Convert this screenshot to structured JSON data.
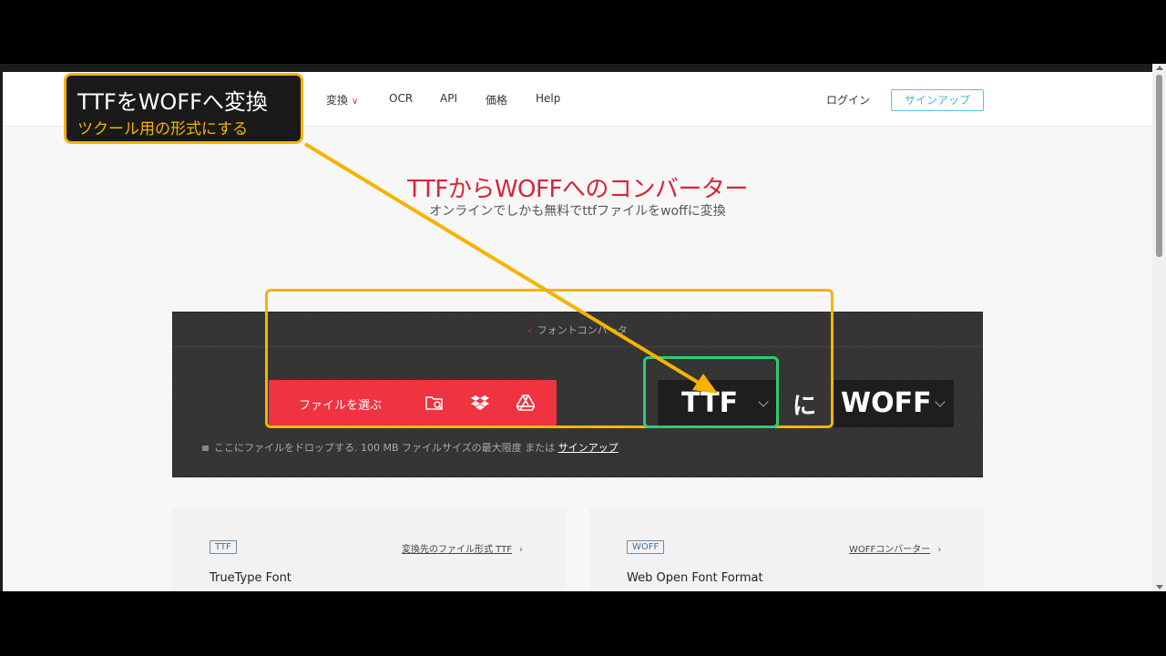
{
  "header": {
    "nav": [
      {
        "label": "変換",
        "has_dropdown": true
      },
      {
        "label": "OCR",
        "has_dropdown": false
      },
      {
        "label": "API",
        "has_dropdown": false
      },
      {
        "label": "価格",
        "has_dropdown": false
      },
      {
        "label": "Help",
        "has_dropdown": false
      }
    ],
    "login_label": "ログイン",
    "signup_label": "サインアップ"
  },
  "hero": {
    "title": "TTFからWOFFへのコンバーター",
    "subtitle": "オンラインでしかも無料でttfファイルをwoffに変換"
  },
  "converter": {
    "breadcrumb": "フォントコンバータ",
    "choose_file_label": "ファイルを選ぶ",
    "from_format": "TTF",
    "to_word": "に",
    "to_format": "WOFF",
    "drop_hint": "ここにファイルをドロップする. 100 MB ファイルサイズの最大限度 または",
    "drop_hint_link": "サインアップ"
  },
  "cards": [
    {
      "badge": "TTF",
      "link": "変換先のファイル形式 TTF",
      "title": "TrueType Font"
    },
    {
      "badge": "WOFF",
      "link": "WOFFコンバーター",
      "title": "Web Open Font Format"
    }
  ],
  "annotation": {
    "title": "TTFをWOFFへ変換",
    "subtitle": "ツクール用の形式にする"
  },
  "colors": {
    "brand_red": "#ef3340",
    "highlight_orange": "#f5b400",
    "highlight_green": "#2ecc71",
    "signup_blue": "#5bc0de"
  }
}
